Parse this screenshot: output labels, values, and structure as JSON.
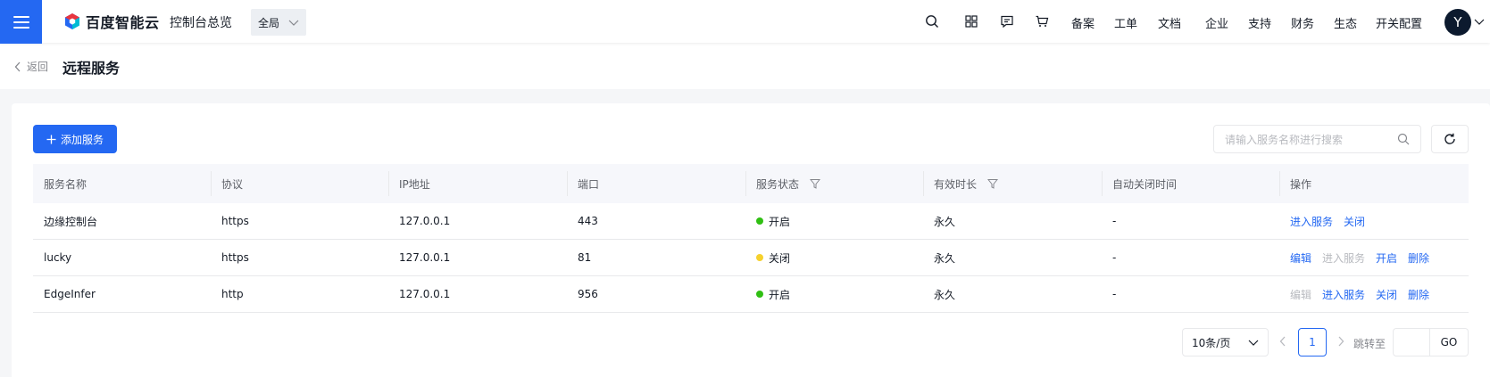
{
  "header": {
    "logo_text": "百度智能云",
    "console_title": "控制台总览",
    "region": "全局",
    "nav_icons": [
      "search-icon",
      "apps-grid-icon",
      "message-icon",
      "cart-icon"
    ],
    "nav_links": [
      "备案",
      "工单",
      "文档",
      "企业",
      "支持",
      "财务",
      "生态",
      "开关配置"
    ],
    "avatar_letter": "Y"
  },
  "page": {
    "back_label": "返回",
    "title": "远程服务"
  },
  "toolbar": {
    "add_button_label": "添加服务",
    "search_placeholder": "请输入服务名称进行搜索"
  },
  "table": {
    "columns": [
      "服务名称",
      "协议",
      "IP地址",
      "端口",
      "服务状态",
      "有效时长",
      "自动关闭时间",
      "操作"
    ],
    "rows": [
      {
        "name": "边缘控制台",
        "protocol": "https",
        "ip": "127.0.0.1",
        "port": "443",
        "status": "开启",
        "status_color": "#30bf13",
        "duration": "永久",
        "auto_close": "-",
        "ops": [
          {
            "label": "进入服务",
            "enabled": true
          },
          {
            "label": "关闭",
            "enabled": true
          }
        ]
      },
      {
        "name": "lucky",
        "protocol": "https",
        "ip": "127.0.0.1",
        "port": "81",
        "status": "关闭",
        "status_color": "#f6d12d",
        "duration": "永久",
        "auto_close": "-",
        "ops": [
          {
            "label": "编辑",
            "enabled": true
          },
          {
            "label": "进入服务",
            "enabled": false
          },
          {
            "label": "开启",
            "enabled": true
          },
          {
            "label": "删除",
            "enabled": true
          }
        ]
      },
      {
        "name": "EdgeInfer",
        "protocol": "http",
        "ip": "127.0.0.1",
        "port": "956",
        "status": "开启",
        "status_color": "#30bf13",
        "duration": "永久",
        "auto_close": "-",
        "ops": [
          {
            "label": "编辑",
            "enabled": false
          },
          {
            "label": "进入服务",
            "enabled": true
          },
          {
            "label": "关闭",
            "enabled": true
          },
          {
            "label": "删除",
            "enabled": true
          }
        ]
      }
    ]
  },
  "pagination": {
    "page_size": "10条/页",
    "current_page": "1",
    "jump_label": "跳转至",
    "go_label": "GO"
  },
  "colors": {
    "accent": "#2468f2",
    "status_on": "#30bf13",
    "status_off": "#f6d12d"
  }
}
